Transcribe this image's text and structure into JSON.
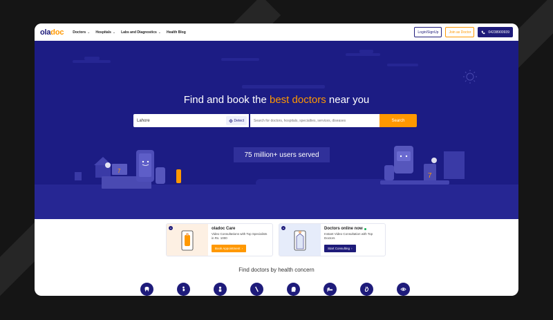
{
  "brand": {
    "logo_main": "ola",
    "logo_accent": "doc",
    "colors": {
      "primary": "#1e1b7a",
      "accent": "#ff9800",
      "hero_bg": "#1c1c84"
    }
  },
  "nav": {
    "items": [
      {
        "label": "Doctors",
        "icon": "chevron-down-icon"
      },
      {
        "label": "Hospitals",
        "icon": "chevron-down-icon"
      },
      {
        "label": "Labs and Diagnostics",
        "icon": "chevron-down-icon"
      },
      {
        "label": "Health Blog"
      }
    ],
    "login_label": "Login/SignUp",
    "join_label": "Join as Doctor",
    "phone": "04238900939"
  },
  "hero": {
    "title_pre": "Find and book the ",
    "title_accent": "best doctors",
    "title_post": " near you",
    "city_value": "Lahore",
    "detect_label": "Detect",
    "search_placeholder": "Search for doctors, hospitals, specialties, services, diseases",
    "search_button": "Search",
    "users_served": "75 million+ users served"
  },
  "cards": [
    {
      "title": "oladoc Care",
      "text": "Video Consultations with Top Specialists in Rs. 1000",
      "button": "Book Appointment"
    },
    {
      "title": "Doctors online now",
      "text": "Instant Video Consultation with Top Doctors",
      "button": "Start Consulting"
    }
  ],
  "concerns": {
    "heading": "Find doctors by health concern",
    "icons": [
      "tooth-icon",
      "pregnancy-icon",
      "child-icon",
      "bone-icon",
      "head-icon",
      "bed-icon",
      "stomach-icon",
      "eye-icon"
    ]
  }
}
